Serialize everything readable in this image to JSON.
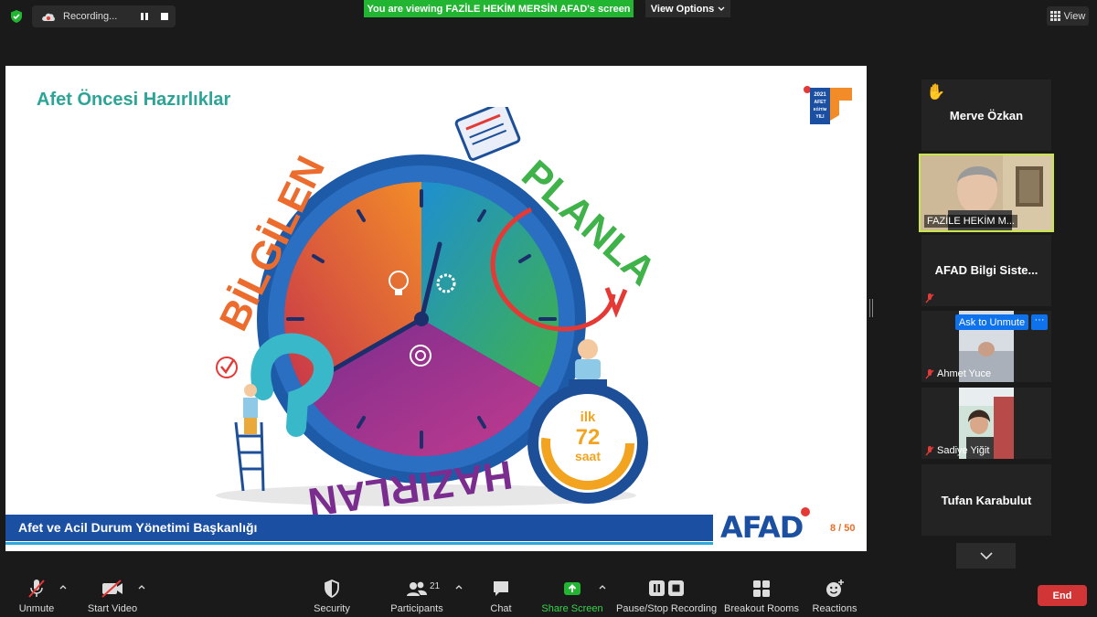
{
  "top_bar": {
    "recording_label": "Recording...",
    "share_banner": "You are viewing FAZİLE HEKİM MERSİN AFAD's screen",
    "view_options_label": "View Options",
    "view_label": "View"
  },
  "slide": {
    "title": "Afet Öncesi Hazırlıklar",
    "logo_text": [
      "2021",
      "AFET",
      "EĞİTİM",
      "YILI"
    ],
    "word_left": "BİLGİLEN",
    "word_right": "PLANLA",
    "word_bottom": "HAZIRLAN",
    "stopwatch_line1": "ilk",
    "stopwatch_line2": "72",
    "stopwatch_line3": "saat",
    "footer_text": "Afet ve Acil Durum Yönetimi Başkanlığı",
    "brand_logo": "AFAD",
    "page_indicator": "8 / 50"
  },
  "participants": {
    "tiles": [
      {
        "name": "Merve Özkan"
      },
      {
        "name": "FAZİLE HEKİM M..."
      },
      {
        "name": "AFAD Bilgi Siste..."
      },
      {
        "name": "Ahmet Yuce"
      },
      {
        "name": "Sadiye Yiğit"
      },
      {
        "name": "Tufan Karabulut"
      }
    ],
    "ask_to_unmute_label": "Ask to Unmute",
    "more_label": "···"
  },
  "toolbar": {
    "unmute": "Unmute",
    "start_video": "Start Video",
    "security": "Security",
    "participants": "Participants",
    "participants_count": "21",
    "chat": "Chat",
    "share_screen": "Share Screen",
    "pause_stop_recording": "Pause/Stop Recording",
    "breakout_rooms": "Breakout Rooms",
    "reactions": "Reactions",
    "end": "End"
  },
  "colors": {
    "share_green": "#22b532",
    "end_red": "#d13535",
    "unmute_blue": "#0e72ed",
    "speaker_highlight": "#c8e64c",
    "slide_title_teal": "#2ba596",
    "afad_blue": "#1b4fa2"
  }
}
